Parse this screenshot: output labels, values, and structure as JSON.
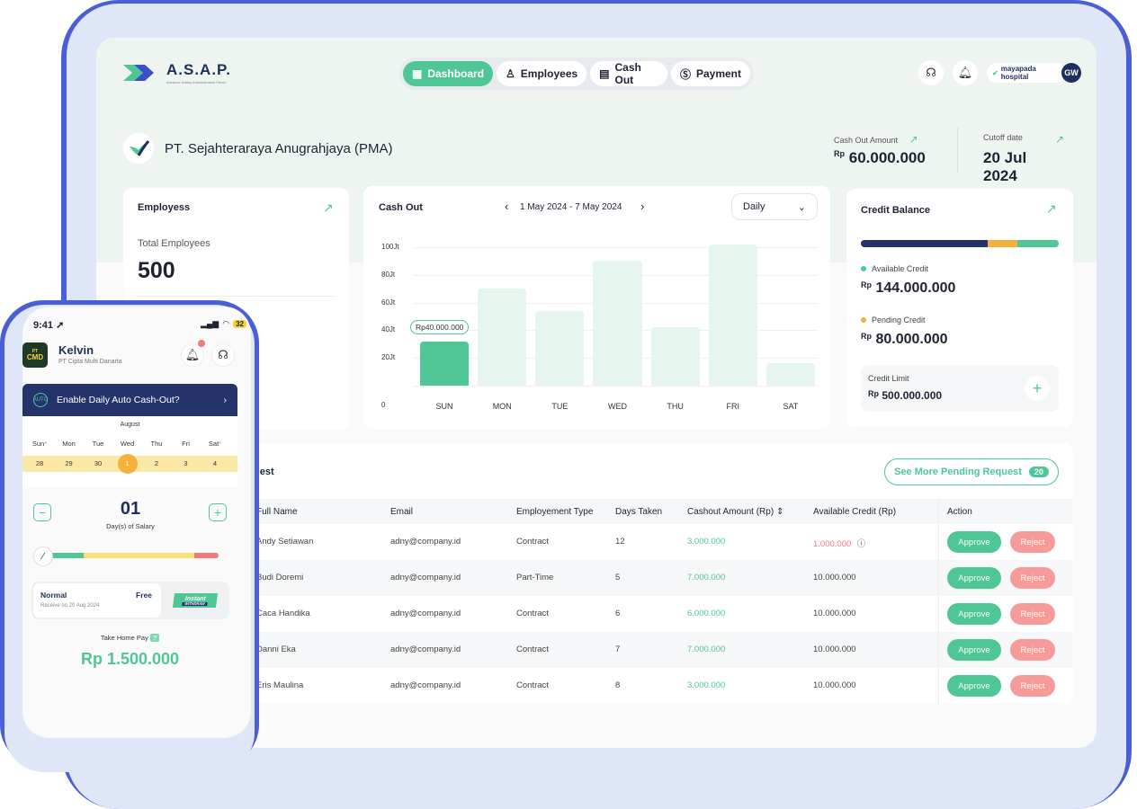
{
  "header": {
    "brand": "A.S.A.P.",
    "brand_sub": "Advance Salary Administration Panel",
    "nav": [
      {
        "label": "Dashboard",
        "icon": "grid-icon",
        "active": true
      },
      {
        "label": "Employees",
        "icon": "users-icon",
        "active": false
      },
      {
        "label": "Cash Out",
        "icon": "receipt-icon",
        "active": false
      },
      {
        "label": "Payment",
        "icon": "dollar-icon",
        "active": false
      }
    ],
    "partner": "mayapada hospital",
    "avatar": "GW"
  },
  "company": {
    "name": "PT. Sejahteraraya Anugrahjaya (PMA)",
    "cashout_label": "Cash Out Amount",
    "cashout_currency": "Rp",
    "cashout_value": "60.000.000",
    "cutoff_label": "Cutoff date",
    "cutoff_value": "20 Jul 2024"
  },
  "employees_card": {
    "title": "Employess",
    "total_label": "Total Employees",
    "total_value": "500"
  },
  "cashout_card": {
    "title": "Cash Out",
    "range": "1 May 2024 - 7 May 2024",
    "period": "Daily",
    "tooltip": "Rp40.000.000"
  },
  "chart_data": {
    "type": "bar",
    "categories": [
      "SUN",
      "MON",
      "TUE",
      "WED",
      "THU",
      "FRI",
      "SAT"
    ],
    "values": [
      32,
      70,
      54,
      90,
      42,
      102,
      16
    ],
    "yticks": [
      "0",
      "20Jt",
      "40Jt",
      "60Jt",
      "80Jt",
      "100Jt"
    ],
    "ylim": [
      0,
      100
    ],
    "highlight_index": 0,
    "colors": {
      "highlight": "#4fc695",
      "bar": "#e6f6ee"
    }
  },
  "credit": {
    "title": "Credit Balance",
    "available_label": "Available Credit",
    "available_currency": "Rp",
    "available_value": "144.000.000",
    "pending_label": "Pending Credit",
    "pending_currency": "Rp",
    "pending_value": "80.000.000",
    "limit_label": "Credit Limit",
    "limit_currency": "Rp",
    "limit_value": "500.000.000",
    "bar_segments": [
      0.64,
      0.15,
      0.21
    ]
  },
  "requests": {
    "title_visible": "uest",
    "see_more": "See More Pending Request",
    "see_more_count": "20",
    "columns": [
      "Full Name",
      "Email",
      "Employement Type",
      "Days Taken",
      "Cashout Amount (Rp)",
      "Available Credit (Rp)",
      "Action"
    ],
    "rows": [
      {
        "name": "Andy Setiawan",
        "email": "adny@company.id",
        "type": "Contract",
        "days": "12",
        "amount": "3.000.000",
        "credit": "1.000.000",
        "credit_warn": true
      },
      {
        "name": "Budi Doremi",
        "email": "adny@company.id",
        "type": "Part-Time",
        "days": "5",
        "amount": "7.000.000",
        "credit": "10.000.000",
        "credit_warn": false
      },
      {
        "name": "Caca Handika",
        "email": "adny@company.id",
        "type": "Contract",
        "days": "6",
        "amount": "6.000.000",
        "credit": "10.000.000",
        "credit_warn": false
      },
      {
        "name": "Danni Eka",
        "email": "adny@company.id",
        "type": "Contract",
        "days": "7",
        "amount": "7.000.000",
        "credit": "10.000.000",
        "credit_warn": false
      },
      {
        "name": "Eris Maulina",
        "email": "adny@company.id",
        "type": "Contract",
        "days": "8",
        "amount": "3.000.000",
        "credit": "10.000.000",
        "credit_warn": false
      }
    ],
    "approve_label": "Approve",
    "reject_label": "Reject"
  },
  "phone": {
    "time": "9:41",
    "battery": "32",
    "user_name": "Kelvin",
    "user_company": "PT Cipta Multi Danarta",
    "badge_small": "PT",
    "badge": "CMD",
    "banner": "Enable Daily Auto Cash-Out?",
    "banner_icon_label": "AUTO",
    "month": "August",
    "weekdays": [
      "Sun",
      "Mon",
      "Tue",
      "Wed",
      "Thu",
      "Fri",
      "Sat"
    ],
    "dates": [
      "28",
      "29",
      "30",
      "1",
      "2",
      "3",
      "4"
    ],
    "days_value": "01",
    "days_label": "Day(s) of Salary",
    "option_normal": "Normal",
    "option_free": "Free",
    "option_receive": "Receive on 20 Aug 2024",
    "option_instant": "Instant",
    "option_instant_sub": "WITHDRAW",
    "take_home_label": "Take Home Pay",
    "take_home_value": "Rp 1.500.000"
  }
}
